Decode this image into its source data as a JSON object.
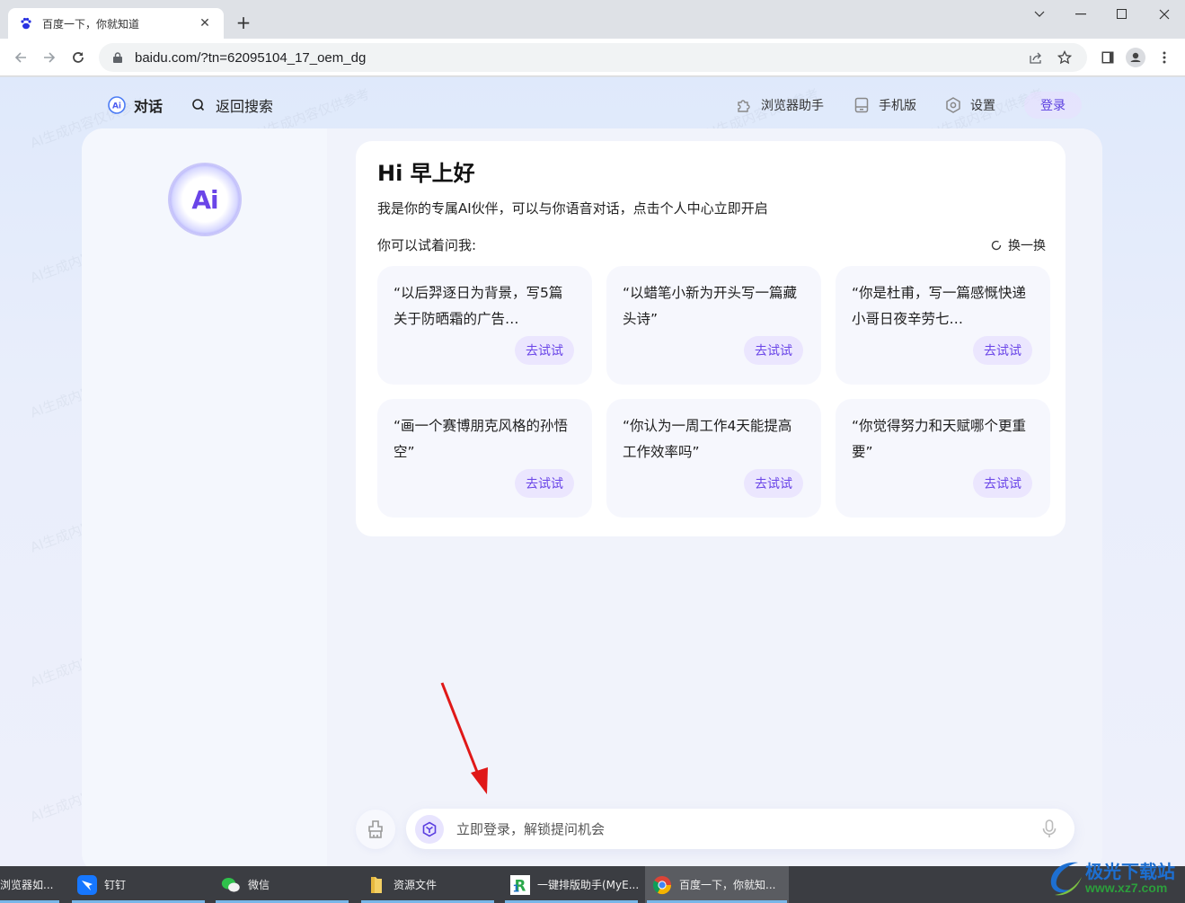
{
  "browser": {
    "tab_title": "百度一下，你就知道",
    "url": "baidu.com/?tn=62095104_17_oem_dg",
    "icons": [
      "baidu-paw-icon",
      "close-icon",
      "plus-icon",
      "back-icon",
      "forward-icon",
      "reload-icon",
      "lock-icon",
      "share-icon",
      "star-icon",
      "side-panel-icon",
      "profile-icon",
      "menu-dots-icon",
      "chevron-down-icon",
      "minimize-icon",
      "maximize-icon",
      "window-close-icon"
    ]
  },
  "nav": {
    "chat_label": "对话",
    "back_search_label": "返回搜索",
    "browser_assistant_label": "浏览器助手",
    "mobile_label": "手机版",
    "settings_label": "设置",
    "login_label": "登录"
  },
  "sidebar": {
    "logo_text": "Ai"
  },
  "welcome": {
    "greeting": "Hi 早上好",
    "intro": "我是你的专属AI伙伴，可以与你语音对话，点击个人中心立即开启",
    "try_label": "你可以试着问我:",
    "refresh_label": "换一换",
    "prompts": [
      {
        "text": "“以后羿逐日为背景，写5篇关于防晒霜的广告…",
        "button": "去试试"
      },
      {
        "text": "“以蜡笔小新为开头写一篇藏头诗”",
        "button": "去试试"
      },
      {
        "text": "“你是杜甫，写一篇感慨快递小哥日夜辛劳七…",
        "button": "去试试"
      },
      {
        "text": "“画一个赛博朋克风格的孙悟空”",
        "button": "去试试"
      },
      {
        "text": "“你认为一周工作4天能提高工作效率吗”",
        "button": "去试试"
      },
      {
        "text": "“你觉得努力和天赋哪个更重要”",
        "button": "去试试"
      }
    ]
  },
  "input": {
    "placeholder": "立即登录，解锁提问机会"
  },
  "watermark": "AI生成内容仅供参考",
  "taskbar": {
    "items": [
      {
        "label": "浏览器如...",
        "active": false
      },
      {
        "label": "钉钉",
        "active": false
      },
      {
        "label": "微信",
        "active": false
      },
      {
        "label": "资源文件",
        "active": false
      },
      {
        "label": "一键排版助手(MyE...",
        "active": false
      },
      {
        "label": "百度一下，你就知...",
        "active": true
      }
    ]
  },
  "site_badge": {
    "name": "极光下载站",
    "url": "www.xz7.com"
  },
  "colors": {
    "accent": "#6a45e8",
    "try_button_bg": "#ebe6fe",
    "annotation_arrow": "#e01818"
  }
}
